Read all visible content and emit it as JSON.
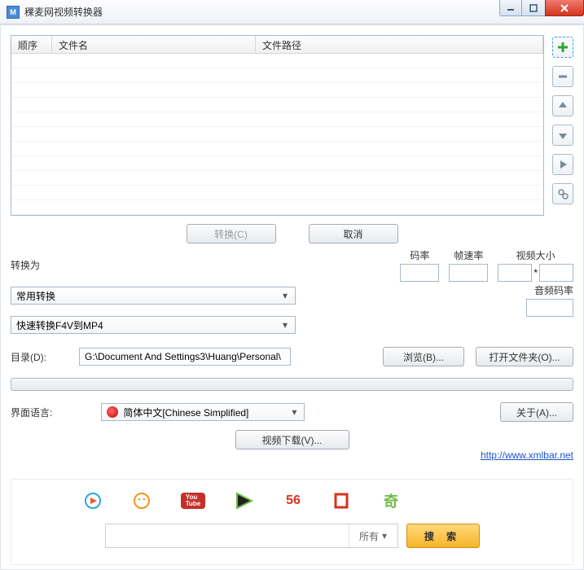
{
  "window": {
    "title": "稞麦网视频转换器"
  },
  "list": {
    "headers": {
      "order": "顺序",
      "name": "文件名",
      "path": "文件路径"
    }
  },
  "actions": {
    "convert": "转换(C)",
    "cancel": "取消"
  },
  "convert": {
    "to_label": "转换为",
    "preset_common": "常用转换",
    "preset_format": "快速转换F4V到MP4"
  },
  "params": {
    "bitrate": "码率",
    "fps": "帧速率",
    "video_size": "视频大小",
    "audio_bitrate": "音频码率"
  },
  "dir": {
    "label": "目录(D):",
    "path": "G:\\Document And Settings3\\Huang\\Personal\\",
    "browse": "浏览(B)...",
    "open": "打开文件夹(O)..."
  },
  "lang": {
    "label": "界面语言:",
    "value": "简体中文[Chinese Simplified]",
    "about": "关于(A)..."
  },
  "download": {
    "button": "视频下载(V)...",
    "link": "http://www.xmlbar.net"
  },
  "search": {
    "category": "所有",
    "button": "搜 索",
    "placeholder": ""
  }
}
